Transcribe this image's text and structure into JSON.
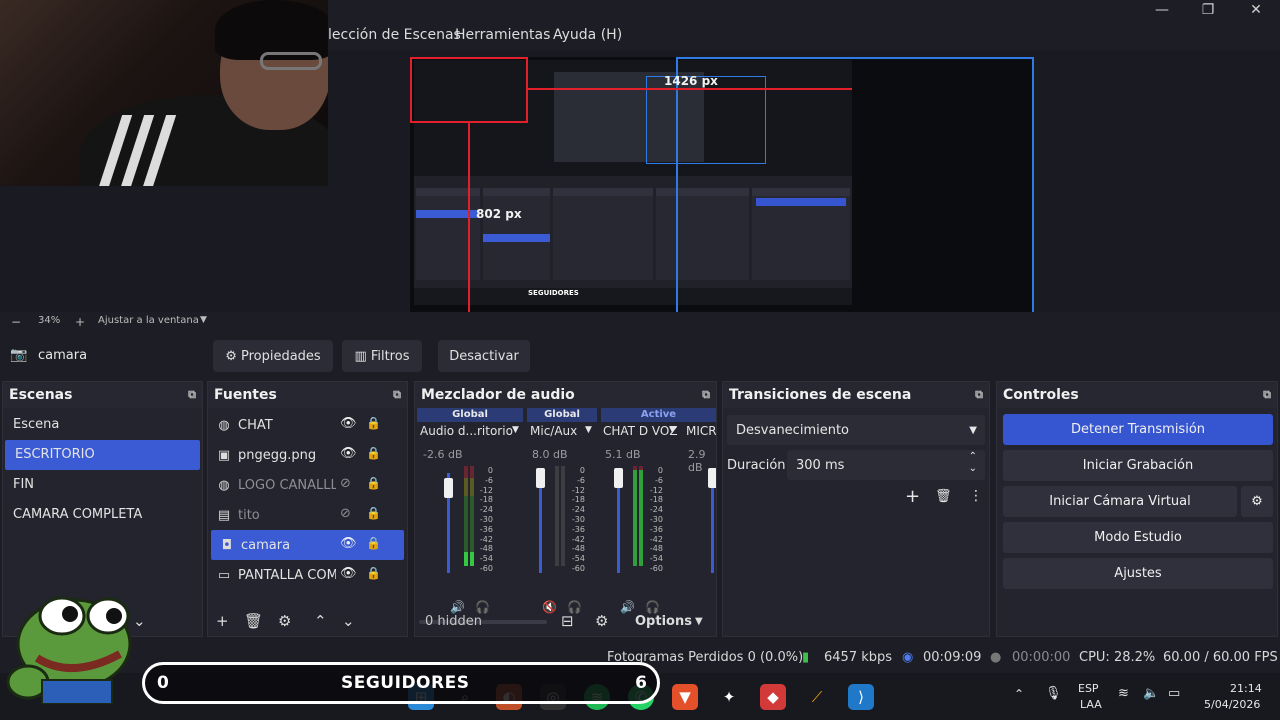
{
  "menu": {
    "items": [
      "lección de Escenas",
      "Herramientas",
      "Ayuda (H)"
    ]
  },
  "window_controls": {
    "minimize": "—",
    "maximize": "❐",
    "close": "✕"
  },
  "preview": {
    "width_label": "1426 px",
    "height_label": "802 px",
    "mini_seguidores": "SEGUIDORES"
  },
  "zoom": {
    "minus": "−",
    "value": "34%",
    "plus": "+",
    "fit_label": "Ajustar a la ventana",
    "dropdown": "▼"
  },
  "source_toolbar": {
    "source_name": "camara",
    "properties": "Propiedades",
    "filters": "Filtros",
    "deactivate": "Desactivar"
  },
  "scenes": {
    "title": "Escenas",
    "items": [
      {
        "label": "Escena"
      },
      {
        "label": "ESCRITORIO",
        "active": true
      },
      {
        "label": "FIN"
      },
      {
        "label": "CAMARA COMPLETA"
      }
    ]
  },
  "sources": {
    "title": "Fuentes",
    "items": [
      {
        "label": "CHAT",
        "icon": "globe-icon",
        "visible": true
      },
      {
        "label": "pngegg.png",
        "icon": "image-icon",
        "visible": true
      },
      {
        "label": "LOGO CANALLL",
        "icon": "globe-icon",
        "visible": false
      },
      {
        "label": "tito",
        "icon": "slideshow-icon",
        "visible": false
      },
      {
        "label": "camara",
        "icon": "camera-icon",
        "visible": true,
        "active": true
      },
      {
        "label": "PANTALLA COMP",
        "icon": "monitor-icon",
        "visible": true
      }
    ]
  },
  "mixer": {
    "title": "Mezclador de audio",
    "headers": [
      "Global",
      "Global",
      "Active"
    ],
    "channels": [
      {
        "name": "Audio d...ritorio",
        "db": "-2.6 dB",
        "level": 0.14,
        "fader": 0.2,
        "muted": false
      },
      {
        "name": "Mic/Aux",
        "db": "8.0 dB",
        "level": 0,
        "fader": 0.05,
        "muted": true
      },
      {
        "name": "CHAT D VOZ",
        "db": "5.1 dB",
        "level": 0.96,
        "fader": 0.08,
        "muted": false
      },
      {
        "name": "MICRO",
        "db": "2.9 dB",
        "level": 0,
        "fader": 0.05,
        "muted": false
      }
    ],
    "scale": [
      "0",
      "-6",
      "-12",
      "-18",
      "-24",
      "-30",
      "-36",
      "-42",
      "-48",
      "-54",
      "-60"
    ],
    "hidden_label": "0 hidden",
    "options_label": "Options"
  },
  "transitions": {
    "title": "Transiciones de escena",
    "selected": "Desvanecimiento",
    "duration_label": "Duración",
    "duration_value": "300 ms"
  },
  "controls": {
    "title": "Controles",
    "stop_stream": "Detener Transmisión",
    "start_recording": "Iniciar Grabación",
    "start_virtual_cam": "Iniciar Cámara Virtual",
    "studio_mode": "Modo Estudio",
    "settings": "Ajustes"
  },
  "status": {
    "dropped_frames": "Fotogramas Perdidos 0 (0.0%)",
    "bitrate": "6457 kbps",
    "stream_time": "00:09:09",
    "record_time": "00:00:00",
    "cpu": "CPU: 28.2%",
    "fps": "60.00 / 60.00 FPS"
  },
  "overlay": {
    "followers_left": "0",
    "followers_label": "SEGUIDORES",
    "followers_right": "6"
  },
  "taskbar": {
    "lang_top": "ESP",
    "lang_bottom": "LAA",
    "time": "21:14",
    "date": "5/04/2026"
  },
  "colors": {
    "accent": "#3655d0",
    "selection": "#3a5bd4",
    "panel_bg": "#23242d",
    "meter_green": "#36c742",
    "outline_red": "#e2202c",
    "outline_blue": "#2f7ae5"
  }
}
